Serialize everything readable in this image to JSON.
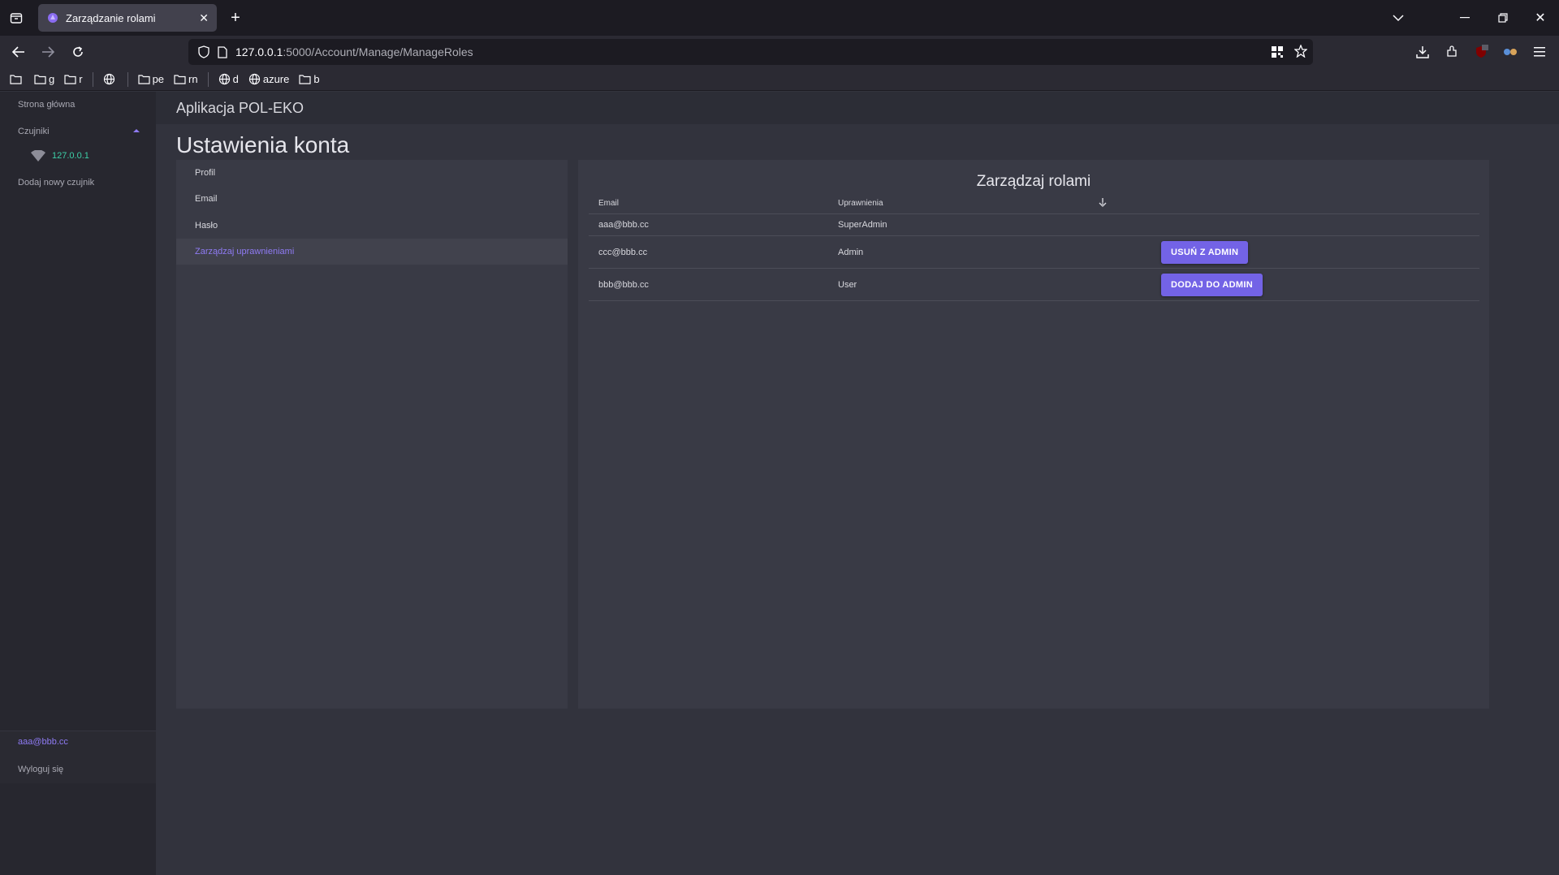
{
  "browser": {
    "tab_title": "Zarządzanie rolami",
    "url_host": "127.0.0.1",
    "url_path": ":5000/Account/Manage/ManageRoles",
    "bookmarks": [
      "g",
      "r",
      "pe",
      "rn",
      "d",
      "azure",
      "b"
    ]
  },
  "sidebar": {
    "home": "Strona główna",
    "sensors": "Czujniki",
    "sensor_ip": "127.0.0.1",
    "add_sensor": "Dodaj nowy czujnik",
    "user_email": "aaa@bbb.cc",
    "logout": "Wyloguj się"
  },
  "app": {
    "title": "Aplikacja POL-EKO",
    "page_title": "Ustawienia konta"
  },
  "account_menu": {
    "items": [
      "Profil",
      "Email",
      "Hasło",
      "Zarządzaj uprawnieniami"
    ],
    "active_index": 3
  },
  "roles": {
    "title": "Zarządzaj rolami",
    "headers": {
      "email": "Email",
      "role": "Uprawnienia",
      "sort_index": "1"
    },
    "rows": [
      {
        "email": "aaa@bbb.cc",
        "role": "SuperAdmin",
        "action": ""
      },
      {
        "email": "ccc@bbb.cc",
        "role": "Admin",
        "action": "USUŃ Z ADMIN"
      },
      {
        "email": "bbb@bbb.cc",
        "role": "User",
        "action": "DODAJ DO ADMIN"
      }
    ]
  },
  "colors": {
    "accent": "#7363e6",
    "link": "#8f7bf4",
    "sensor_online": "#3dd0a8"
  }
}
